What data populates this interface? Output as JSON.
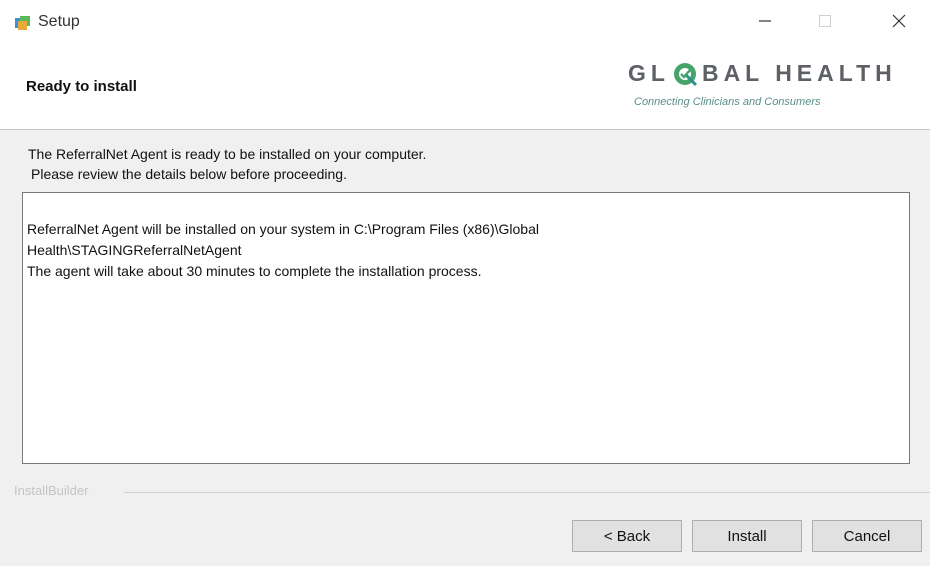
{
  "window": {
    "title": "Setup",
    "controls": {
      "minimize": "minimize-icon",
      "maximize": "maximize-icon",
      "close": "close-icon"
    }
  },
  "header": {
    "heading": "Ready to install",
    "logo": {
      "word_left": "GL",
      "word_right": "BAL HEALTH",
      "tagline": "Connecting Clinicians and Consumers",
      "colors": {
        "text": "#5d6166",
        "accent_green": "#46a36a",
        "accent_teal": "#2f8f8a"
      }
    }
  },
  "body": {
    "intro_line1": "The ReferralNet Agent is ready to be installed on your computer.",
    "intro_line2": "Please review the details below before proceeding.",
    "details_line1": "ReferralNet Agent will be installed on your system in C:\\Program Files (x86)\\Global",
    "details_line2": "Health\\STAGINGReferralNetAgent",
    "details_line3": "The agent will take about 30 minutes to complete the installation process."
  },
  "footer": {
    "brand": "InstallBuilder",
    "buttons": {
      "back": "< Back",
      "install": "Install",
      "cancel": "Cancel"
    }
  }
}
